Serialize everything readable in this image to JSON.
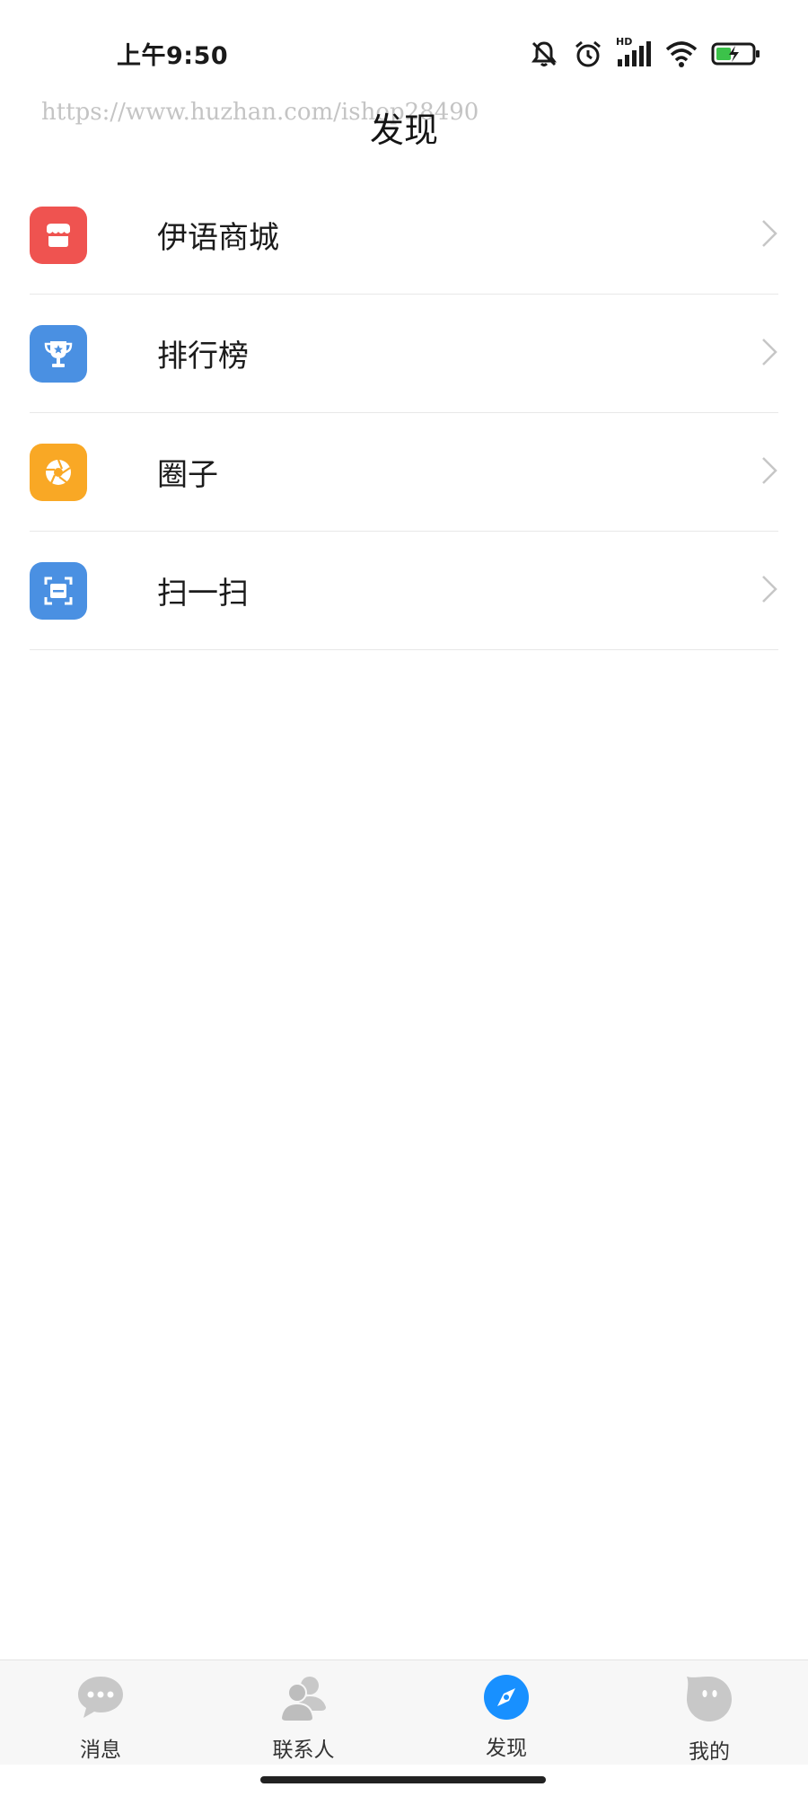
{
  "status_bar": {
    "time": "上午9:50",
    "hd_label": "HD",
    "icons": [
      "bell-muted-icon",
      "alarm-icon",
      "signal-icon",
      "wifi-icon",
      "battery-charging-icon"
    ]
  },
  "watermark": "https://www.huzhan.com/ishop28490",
  "page": {
    "title": "发现"
  },
  "menu": {
    "items": [
      {
        "label": "伊语商城",
        "icon": "shop-icon",
        "color": "#ef5350"
      },
      {
        "label": "排行榜",
        "icon": "trophy-icon",
        "color": "#4a90e2"
      },
      {
        "label": "圈子",
        "icon": "aperture-icon",
        "color": "#f9a825"
      },
      {
        "label": "扫一扫",
        "icon": "scan-icon",
        "color": "#4a90e2"
      }
    ]
  },
  "bottom_nav": {
    "items": [
      {
        "label": "消息",
        "icon": "chat-bubble-icon",
        "active": false
      },
      {
        "label": "联系人",
        "icon": "contacts-icon",
        "active": false
      },
      {
        "label": "发现",
        "icon": "compass-icon",
        "active": true
      },
      {
        "label": "我的",
        "icon": "profile-face-icon",
        "active": false
      }
    ],
    "active_color": "#1890ff",
    "inactive_color": "#c8c8c8"
  }
}
